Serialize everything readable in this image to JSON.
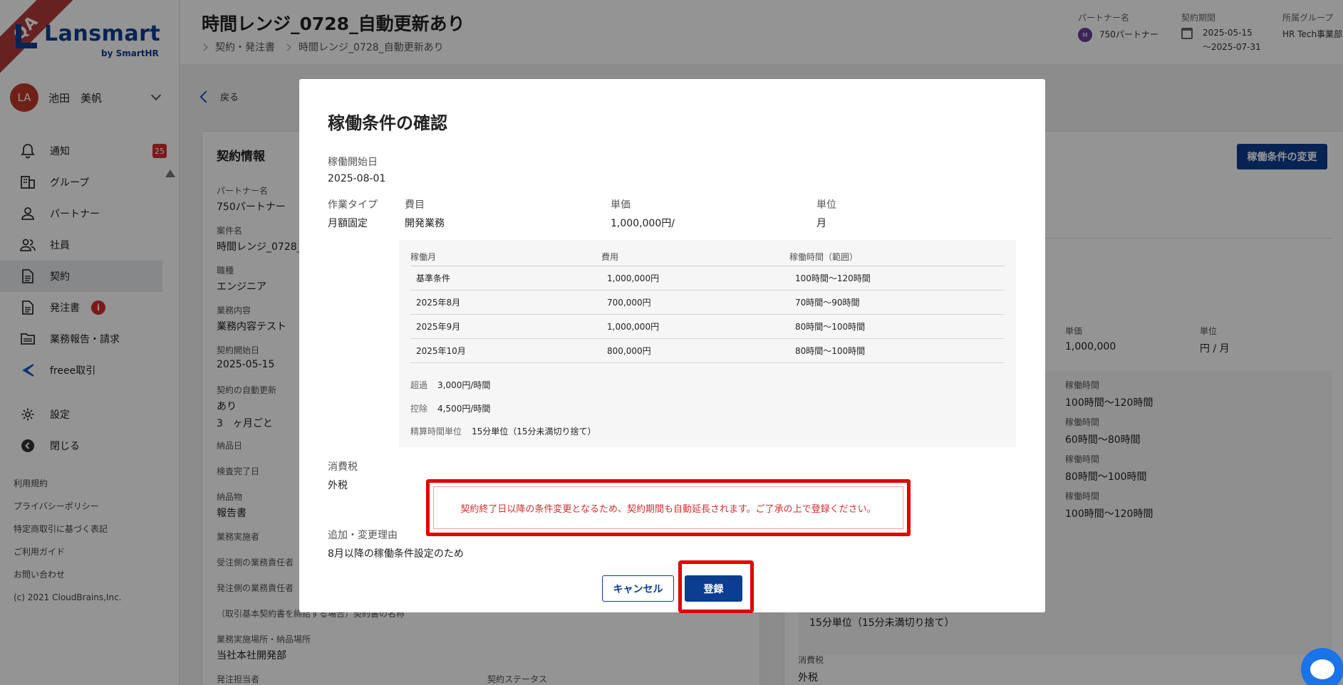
{
  "app": {
    "qa_ribbon": "QA",
    "logo_text": "Lansmart",
    "logo_sub": "by SmartHR",
    "user": {
      "avatar_initials": "LA",
      "name": "池田　美帆"
    }
  },
  "sidebar": {
    "items": [
      {
        "label": "通知",
        "icon": "bell-icon",
        "badge": "25"
      },
      {
        "label": "グループ",
        "icon": "building-icon"
      },
      {
        "label": "パートナー",
        "icon": "person-icon"
      },
      {
        "label": "社員",
        "icon": "people-icon"
      },
      {
        "label": "契約",
        "icon": "document-icon",
        "active": true
      },
      {
        "label": "発注書",
        "icon": "document-icon",
        "badge": "i"
      },
      {
        "label": "業務報告・請求",
        "icon": "folder-icon"
      },
      {
        "label": "freee取引",
        "icon": "freee-icon"
      }
    ],
    "bottom_items": [
      {
        "label": "設定",
        "icon": "gear-icon"
      },
      {
        "label": "閉じる",
        "icon": "collapse-icon"
      }
    ],
    "footer_links": [
      "利用規約",
      "プライバシーポリシー",
      "特定商取引に基づく表記",
      "ご利用ガイド",
      "お問い合わせ",
      "(c) 2021 CloudBrains,Inc."
    ]
  },
  "header": {
    "title": "時間レンジ_0728_自動更新あり",
    "breadcrumb": [
      "契約・発注書",
      "時間レンジ_0728_自動更新あり"
    ],
    "partner": {
      "label": "パートナー名",
      "avatar": "M",
      "value": "750パートナー"
    },
    "period": {
      "label": "契約期間",
      "start": "2025-05-15",
      "end": "〜2025-07-31"
    },
    "group": {
      "label": "所属グループ",
      "value": "HR Tech事業部"
    }
  },
  "main": {
    "back_label": "戻る",
    "left_card": {
      "title": "契約情報",
      "fields": [
        {
          "label": "パートナー名",
          "value": "750パートナー"
        },
        {
          "label": "案件名",
          "value": "時間レンジ_0728_"
        },
        {
          "label": "職種",
          "value": "エンジニア"
        },
        {
          "label": "業務内容",
          "value": "業務内容テスト"
        },
        {
          "label": "契約開始日",
          "value": "2025-05-15"
        },
        {
          "label": "契約の自動更新",
          "value": "あり"
        },
        {
          "label": "納品日",
          "value": ""
        },
        {
          "label": "検査完了日",
          "value": ""
        },
        {
          "label": "納品物",
          "value": "報告書"
        },
        {
          "label": "業務実施者",
          "value": ""
        },
        {
          "label": "受注側の業務責任者",
          "value": ""
        },
        {
          "label": "発注側の業務責任者",
          "value": ""
        },
        {
          "label": "業務実施場所・納品場所",
          "value": "当社本社開発部"
        },
        {
          "label": "発注担当者",
          "value": ""
        }
      ],
      "auto_renew_period": "3　ヶ月ごと",
      "basic_contract_note": "（取引基本契約書を締結する場合）契約書の名称",
      "status_label": "契約ステータス"
    },
    "right_card": {
      "change_button": "稼働条件の変更",
      "unit_price_label": "単価",
      "unit_price_value": "1,000,000",
      "unit_label": "単位",
      "unit_value": "円 / 月",
      "hours": [
        {
          "label": "稼働時間",
          "value": "100時間〜120時間"
        },
        {
          "label": "稼働時間",
          "value": "60時間〜80時間"
        },
        {
          "label": "稼働時間",
          "value": "80時間〜100時間"
        },
        {
          "label": "稼働時間",
          "value": "100時間〜120時間"
        }
      ],
      "rounding": "15分単位（15分未満切り捨て）",
      "tax_label": "消費税",
      "tax_value": "外税"
    }
  },
  "modal": {
    "title": "稼働条件の確認",
    "start_label": "稼働開始日",
    "start_value": "2025-08-01",
    "work_type_label": "作業タイプ",
    "work_type_value": "月額固定",
    "expense_label": "費目",
    "expense_value": "開発業務",
    "price_label": "単価",
    "price_value": "1,000,000円/",
    "unit_label": "単位",
    "unit_value": "月",
    "table": {
      "headers": [
        "稼働月",
        "費用",
        "稼働時間（範囲）"
      ],
      "rows": [
        [
          "基準条件",
          "1,000,000円",
          "100時間〜120時間"
        ],
        [
          "2025年8月",
          "700,000円",
          "70時間〜90時間"
        ],
        [
          "2025年9月",
          "1,000,000円",
          "80時間〜100時間"
        ],
        [
          "2025年10月",
          "800,000円",
          "80時間〜100時間"
        ]
      ]
    },
    "overtime_label": "超過",
    "overtime_value": "3,000円/時間",
    "deduction_label": "控除",
    "deduction_value": "4,500円/時間",
    "settlement_label": "精算時間単位",
    "settlement_value": "15分単位（15分未満切り捨て）",
    "tax_label": "消費税",
    "tax_value": "外税",
    "warning": "契約終了日以降の条件変更となるため、契約期間も自動延長されます。ご了承の上で登録ください。",
    "reason_label": "追加・変更理由",
    "reason_value": "8月以降の稼働条件設定のため",
    "cancel_label": "キャンセル",
    "register_label": "登録"
  },
  "colors": {
    "brand": "#0b3d91",
    "warning": "#e00000",
    "badge": "#d32f2f"
  }
}
